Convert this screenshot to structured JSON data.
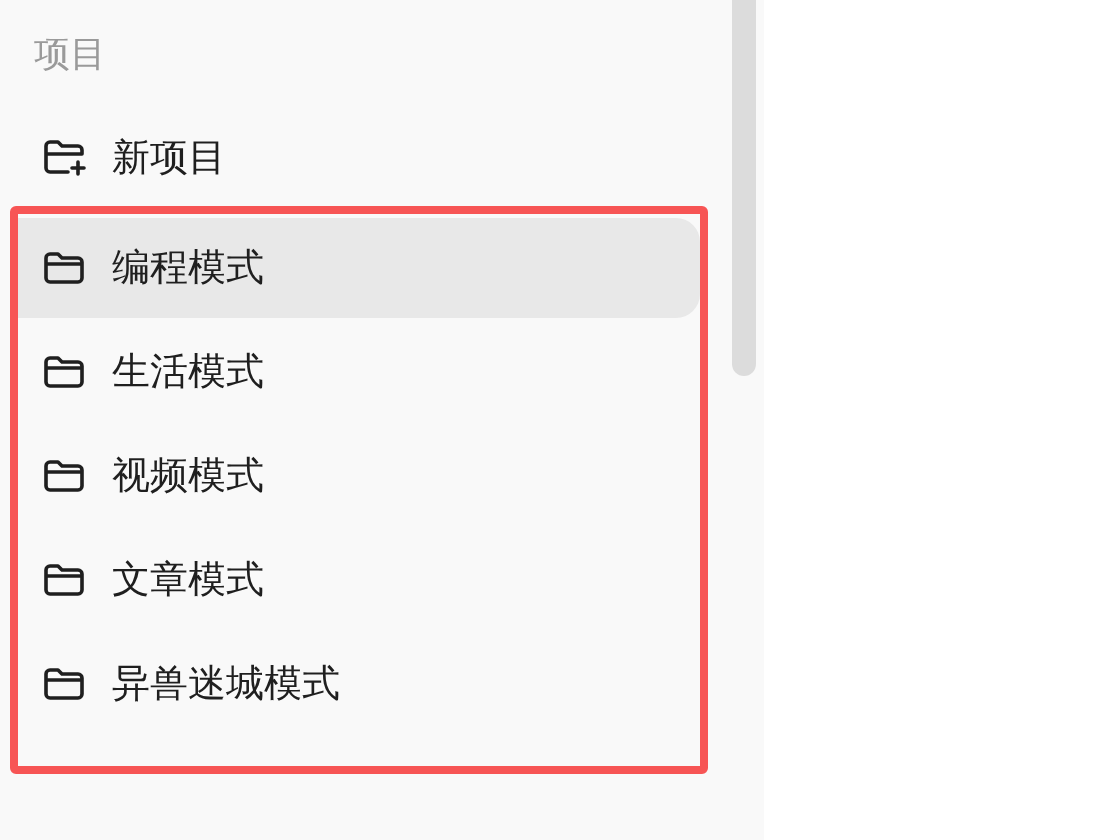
{
  "sidebar": {
    "section_title": "项目",
    "new_project": {
      "label": "新项目"
    },
    "projects": [
      {
        "label": "编程模式",
        "selected": true
      },
      {
        "label": "生活模式",
        "selected": false
      },
      {
        "label": "视频模式",
        "selected": false
      },
      {
        "label": "文章模式",
        "selected": false
      },
      {
        "label": "异兽迷城模式",
        "selected": false
      }
    ]
  }
}
